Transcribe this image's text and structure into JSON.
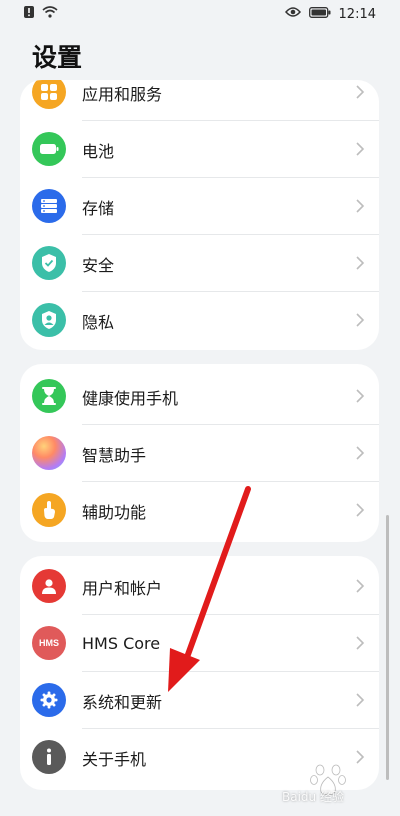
{
  "status": {
    "time": "12:14"
  },
  "page_title": "设置",
  "colors": {
    "red_arrow": "#e11b1b"
  },
  "groups": [
    {
      "items": [
        {
          "label": "应用和服务",
          "icon": "apps-icon",
          "color": "#f5a623"
        },
        {
          "label": "电池",
          "icon": "battery-icon",
          "color": "#34c759"
        },
        {
          "label": "存储",
          "icon": "storage-icon",
          "color": "#2b6bea"
        },
        {
          "label": "安全",
          "icon": "shield-icon",
          "color": "#3bbfa8"
        },
        {
          "label": "隐私",
          "icon": "privacy-icon",
          "color": "#3bbfa8"
        }
      ]
    },
    {
      "items": [
        {
          "label": "健康使用手机",
          "icon": "hourglass-icon",
          "color": "#34c759"
        },
        {
          "label": "智慧助手",
          "icon": "assistant-orb-icon",
          "color": "#ff8a65"
        },
        {
          "label": "辅助功能",
          "icon": "hand-icon",
          "color": "#f5a623"
        }
      ]
    },
    {
      "items": [
        {
          "label": "用户和帐户",
          "icon": "user-icon",
          "color": "#e53935"
        },
        {
          "label": "HMS Core",
          "icon": "hms-icon",
          "color": "#e05a5a",
          "badge_text": "HMS"
        },
        {
          "label": "系统和更新",
          "icon": "gear-icon",
          "color": "#2b6bea"
        },
        {
          "label": "关于手机",
          "icon": "info-icon",
          "color": "#5a5a5a"
        }
      ]
    }
  ],
  "watermark": {
    "text": "Baidu 经验"
  }
}
